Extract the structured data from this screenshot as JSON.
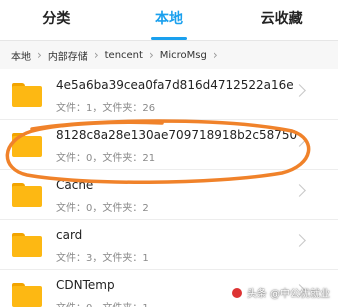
{
  "tabs": [
    {
      "label": "分类",
      "active": false
    },
    {
      "label": "本地",
      "active": true
    },
    {
      "label": "云收藏",
      "active": false
    }
  ],
  "breadcrumb": [
    "本地",
    "内部存储",
    "tencent",
    "MicroMsg"
  ],
  "breadcrumb_separator": "›",
  "files": [
    {
      "name": "4e5a6ba39cea0fa7d816d4712522a16e",
      "meta": "文件：1，文件夹：26"
    },
    {
      "name": "8128c8a28e130ae709718918b2c58750",
      "meta": "文件：0，文件夹：21",
      "highlighted": true
    },
    {
      "name": "Cache",
      "meta": "文件：0，文件夹：2"
    },
    {
      "name": "card",
      "meta": "文件：3，文件夹：1"
    },
    {
      "name": "CDNTemp",
      "meta": "文件：0，文件夹：1"
    }
  ],
  "watermark": {
    "text": "头条 @中公优就业"
  },
  "colors": {
    "accent": "#1aa0ee",
    "folder": "#fdb813",
    "annotation": "#f0822a"
  }
}
